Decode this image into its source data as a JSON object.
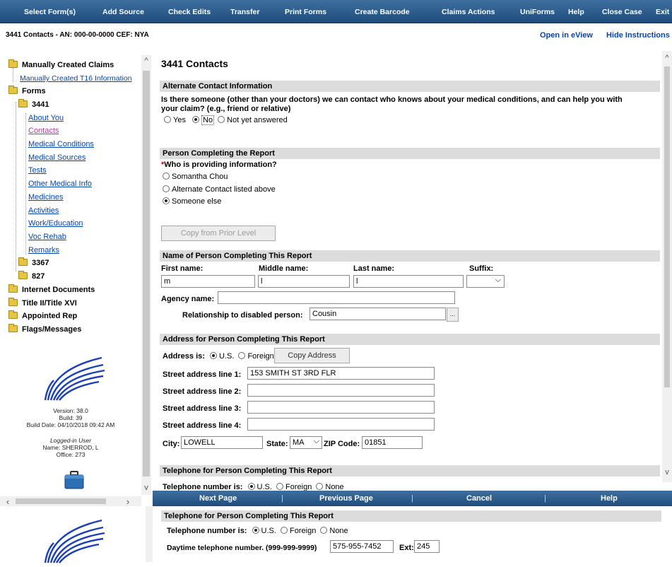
{
  "menu": {
    "items": [
      "Select Form(s)",
      "Add Source",
      "Check Edits",
      "Transfer",
      "Print Forms",
      "Create Barcode",
      "Claims Actions",
      "UniForms",
      "Help",
      "Close Case",
      "Exit"
    ]
  },
  "case_bar": {
    "case_info": "3441 Contacts - AN: 000-00-0000  CEF: NYA",
    "open_eview": "Open in eView",
    "hide_instructions": "Hide Instructions"
  },
  "sidebar": {
    "manual_claims": "Manually Created Claims",
    "manual_t16": "Manually Created T16 Information",
    "forms": "Forms",
    "f3441": "3441",
    "links": [
      "About You",
      "Contacts",
      "Medical Conditions",
      "Medical Sources",
      "Tests",
      "Other Medical Info",
      "Medicines",
      "Activities",
      "Work/Education",
      "Voc Rehab",
      "Remarks"
    ],
    "f3367": "3367",
    "f827": "827",
    "internet_docs": "Internet Documents",
    "title_ii": "Title II/Title XVI",
    "appointed_rep": "Appointed Rep",
    "flags": "Flags/Messages",
    "version": "Version: 38.0",
    "build": "Build: 39",
    "build_date": "Build Date: 04/10/2018 09:42 AM",
    "logged_in": "Logged-in User",
    "name": "Name: SHERROD, L",
    "office": "Office: 273"
  },
  "main": {
    "page_title": "3441 Contacts",
    "alt_contact": {
      "header": "Alternate Contact Information",
      "question_line1": "Is there someone (other than your doctors) we can contact who knows about your medical conditions, and can help you with",
      "question_line2": "your claim? (e.g., friend or relative)",
      "yes": "Yes",
      "no": "No",
      "not_answered": "Not yet answered"
    },
    "person": {
      "header": "Person Completing the Report",
      "question": "Who is providing information?",
      "required_mark": "*",
      "opt1": "Somantha Chou",
      "opt2": "Alternate Contact listed above",
      "opt3": "Someone else",
      "copy_prior": "Copy from Prior Level"
    },
    "name": {
      "header": "Name of Person Completing This Report",
      "first_label": "First name:",
      "middle_label": "Middle name:",
      "last_label": "Last name:",
      "suffix_label": "Suffix:",
      "first_value": "m",
      "middle_value": "l",
      "last_value": "l",
      "agency_label": "Agency name:",
      "relationship_label": "Relationship to disabled person:",
      "relationship_value": "Cousin",
      "ellipsis": "..."
    },
    "address": {
      "header": "Address for Person Completing This Report",
      "address_is": "Address is:",
      "us": "U.S.",
      "foreign": "Foreign",
      "copy_address": "Copy Address",
      "line1_label": "Street address line 1:",
      "line1_value": "153 SMITH ST 3RD FLR",
      "line2_label": "Street address line 2:",
      "line3_label": "Street address line 3:",
      "line4_label": "Street address line 4:",
      "city_label": "City:",
      "city_value": "LOWELL",
      "state_label": "State:",
      "state_value": "MA",
      "zip_label": "ZIP Code:",
      "zip_value": "01851"
    },
    "telephone": {
      "header": "Telephone for Person Completing This Report",
      "number_is": "Telephone number is:",
      "us": "U.S.",
      "foreign": "Foreign",
      "none": "None"
    }
  },
  "nav": {
    "next": "Next Page",
    "previous": "Previous Page",
    "cancel": "Cancel",
    "help": "Help",
    "sep": "|"
  },
  "lower": {
    "header": "Telephone for Person Completing This Report",
    "number_is": "Telephone number is:",
    "us": "U.S.",
    "foreign": "Foreign",
    "none": "None",
    "daytime_label": "Daytime telephone number. (999-999-9999)",
    "daytime_value": "575-955-7452",
    "ext_label": "Ext:",
    "ext_value": "245"
  }
}
